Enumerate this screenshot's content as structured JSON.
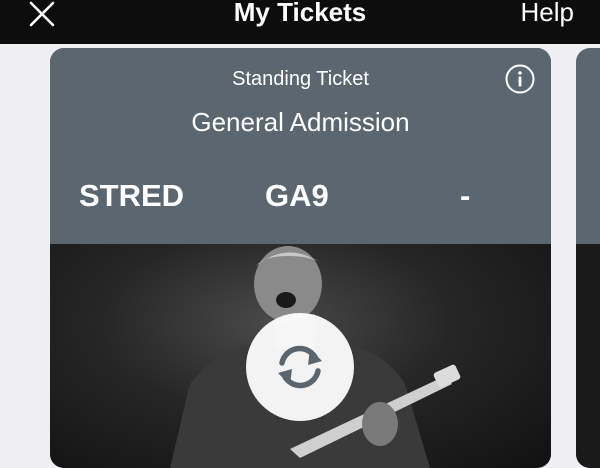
{
  "nav": {
    "title": "My Tickets",
    "help_label": "Help",
    "close_icon": "close-icon"
  },
  "ticket": {
    "type": "Standing Ticket",
    "admission": "General Admission",
    "section": "STRED",
    "row": "GA9",
    "seat": "-",
    "info_icon": "info-icon",
    "image": "performer-photo",
    "action_icon": "rotate-icon"
  },
  "colors": {
    "nav_bar": "#0d0d0d",
    "card": "#5a6670",
    "background": "#efeff2"
  }
}
